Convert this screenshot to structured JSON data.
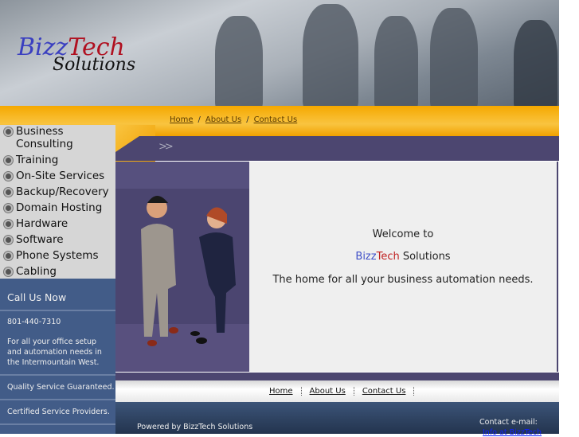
{
  "logo": {
    "part1": "Bizz",
    "part2": "Tech",
    "part3": "Solutions"
  },
  "breadcrumb": {
    "home": "Home",
    "about": "About Us",
    "contact": "Contact Us",
    "sep": "/"
  },
  "arrows": ">>",
  "menu": [
    "Business Consulting",
    "Training",
    "On-Site Services",
    "Backup/Recovery",
    "Domain Hosting",
    "Hardware",
    "Software",
    "Phone Systems",
    "Cabling"
  ],
  "welcome": {
    "line1": "Welcome to",
    "bizz": "Bizz",
    "tech": "Tech",
    "solutions": " Solutions",
    "line3": "The home for all your business automation needs."
  },
  "sidebar": {
    "title": "Call Us Now",
    "phone": "801-440-7310",
    "blurb": "For all your office setup and automation needs in the Intermountain West.",
    "quality": "Quality Service Guaranteed.",
    "certified": "Certified Service Providers."
  },
  "footer_nav": {
    "home": "Home",
    "about": "About Us",
    "contact": "Contact Us"
  },
  "footer": {
    "powered": "Powered by BizzTech Solutions",
    "contact_label": "Contact e-mail:",
    "email": "Info at BizzTech"
  }
}
